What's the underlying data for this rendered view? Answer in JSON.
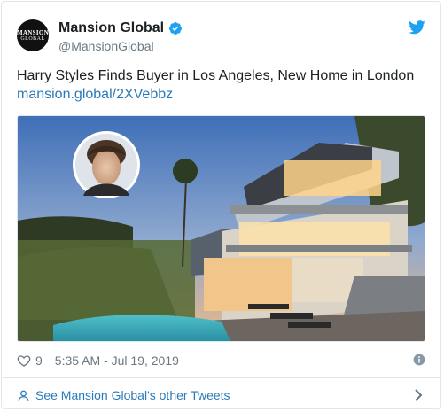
{
  "account": {
    "avatar_line1": "MANSION",
    "avatar_line2": "GLOBAL",
    "display_name": "Mansion Global",
    "handle": "@MansionGlobal"
  },
  "tweet": {
    "text": "Harry Styles Finds Buyer in Los Angeles, New Home in London",
    "link": "mansion.global/2XVebbz"
  },
  "meta": {
    "likes": "9",
    "timestamp": "5:35 AM - Jul 19, 2019"
  },
  "footer": {
    "see_more": "See Mansion Global's other Tweets"
  },
  "colors": {
    "link": "#2b7bb9",
    "secondary_text": "#697882",
    "verified": "#1da1f2",
    "twitter_brand": "#1da1f2"
  },
  "icons": [
    "verified-badge-icon",
    "twitter-bird-icon",
    "heart-icon",
    "info-icon",
    "person-icon",
    "chevron-right-icon"
  ]
}
